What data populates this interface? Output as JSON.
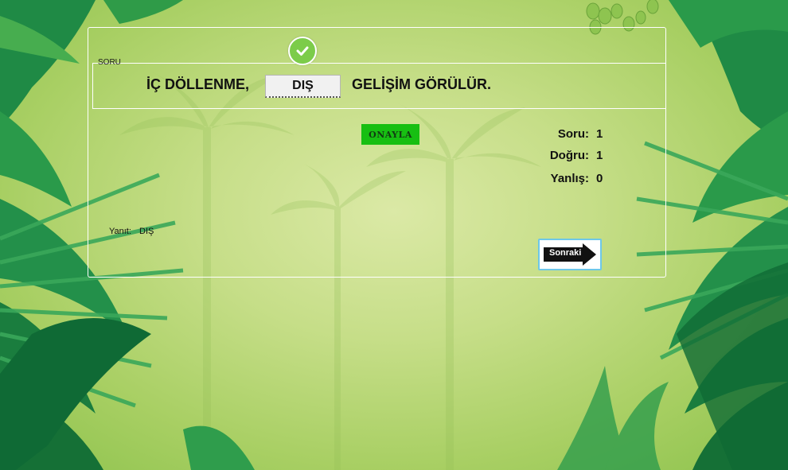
{
  "question": {
    "group_label": "SORU",
    "part1": "İÇ DÖLLENME,",
    "answer_value": "DIŞ",
    "part2": "GELİŞİM GÖRÜLÜR."
  },
  "confirm_button": {
    "label": "ONAYLA"
  },
  "stats": {
    "question_label": "Soru:",
    "question_value": "1",
    "correct_label": "Doğru:",
    "correct_value": "1",
    "wrong_label": "Yanlış:",
    "wrong_value": "0"
  },
  "answer": {
    "caption": "Yanıt:",
    "value": "DIŞ"
  },
  "next_button": {
    "label": "Sonraki",
    "icon": "right-arrow-icon"
  },
  "status_icon": "check-circle-icon",
  "colors": {
    "confirm": "#17bf12",
    "check": "#7ccc4a",
    "frame": "#ffffff",
    "next_border": "#6ec7e8"
  }
}
